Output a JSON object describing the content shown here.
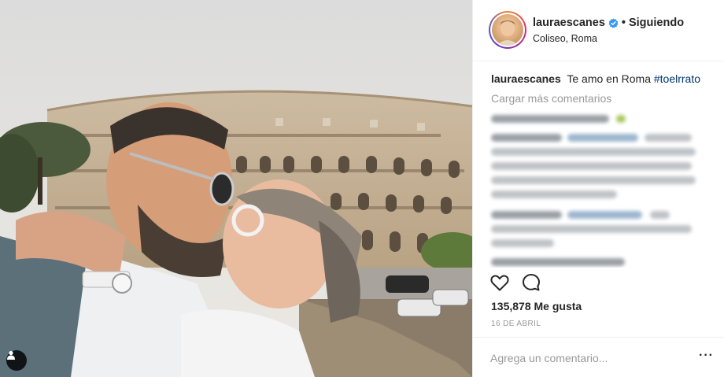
{
  "post": {
    "username": "lauraescanes",
    "follow_separator": "•",
    "follow_status": "Siguiendo",
    "location": "Coliseo, Roma",
    "caption_user": "lauraescanes",
    "caption_text": "Te amo en Roma",
    "caption_hashtag": "#toelrrato",
    "load_more": "Cargar más comentarios",
    "likes": "135,878 Me gusta",
    "date": "16 DE ABRIL",
    "comment_placeholder": "Agrega un comentario...",
    "more_options": "···"
  },
  "icons": {
    "verified": "verified-badge-icon",
    "like": "heart-icon",
    "comment": "comment-icon",
    "tag": "user-tag-icon"
  },
  "colors": {
    "verified": "#3897f0",
    "hashtag": "#003569",
    "muted": "#999999",
    "text": "#262626"
  }
}
